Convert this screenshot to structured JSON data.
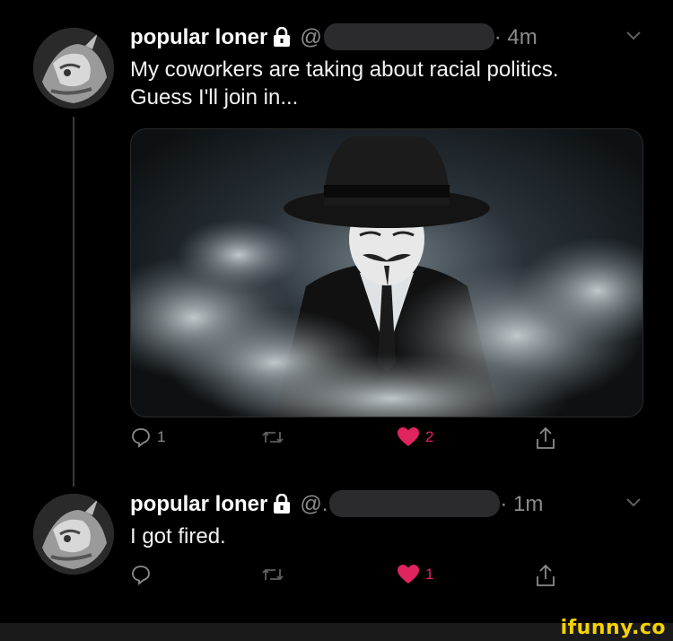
{
  "tweets": [
    {
      "name": "popular loner",
      "handle": "@",
      "time": "· 4m",
      "text_lines": [
        "My coworkers are taking about racial politics.",
        "Guess I'll join in..."
      ],
      "has_media": true,
      "actions": {
        "reply_count": "1",
        "retweet_count": "",
        "like_count": "2",
        "liked": true
      }
    },
    {
      "name": "popular loner",
      "handle": "@.",
      "time": "· 1m",
      "text_lines": [
        "I got fired."
      ],
      "has_media": false,
      "actions": {
        "reply_count": "",
        "retweet_count": "",
        "like_count": "1",
        "liked": true
      }
    }
  ],
  "watermark": "ifunny.co",
  "icons": {
    "lock": "lock-icon",
    "chevron": "chevron-down-icon",
    "reply": "reply-icon",
    "retweet": "retweet-icon",
    "like": "heart-icon",
    "share": "share-icon"
  },
  "colors": {
    "like": "#e0245e",
    "muted": "#8b8b8b",
    "watermark": "#f6d200"
  }
}
